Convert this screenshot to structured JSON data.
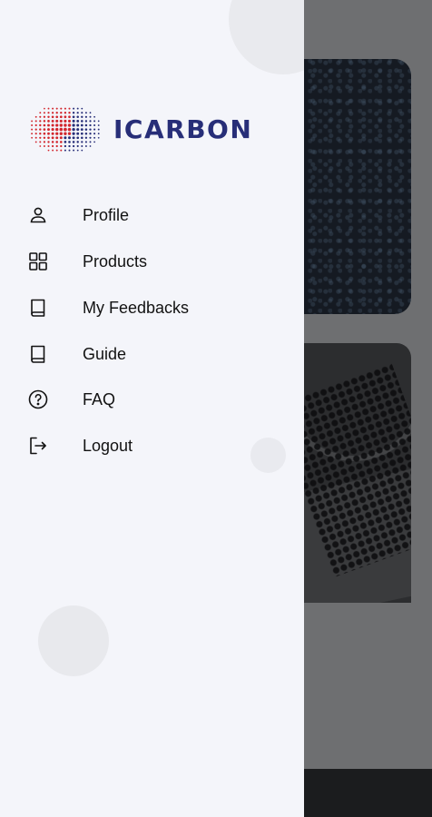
{
  "brand": {
    "name": "ICARBON",
    "text_color": "#272e78",
    "dot_red": "#d2262d",
    "dot_navy": "#272e78"
  },
  "menu": {
    "items": [
      {
        "label": "Profile",
        "icon": "user-icon"
      },
      {
        "label": "Products",
        "icon": "grid-icon"
      },
      {
        "label": "My Feedbacks",
        "icon": "book-icon"
      },
      {
        "label": "Guide",
        "icon": "book-icon"
      },
      {
        "label": "FAQ",
        "icon": "question-circle-icon"
      },
      {
        "label": "Logout",
        "icon": "logout-icon"
      }
    ]
  },
  "colors": {
    "drawer_bg": "#f4f5fa",
    "overlay": "#6e6f71",
    "text": "#121212"
  }
}
